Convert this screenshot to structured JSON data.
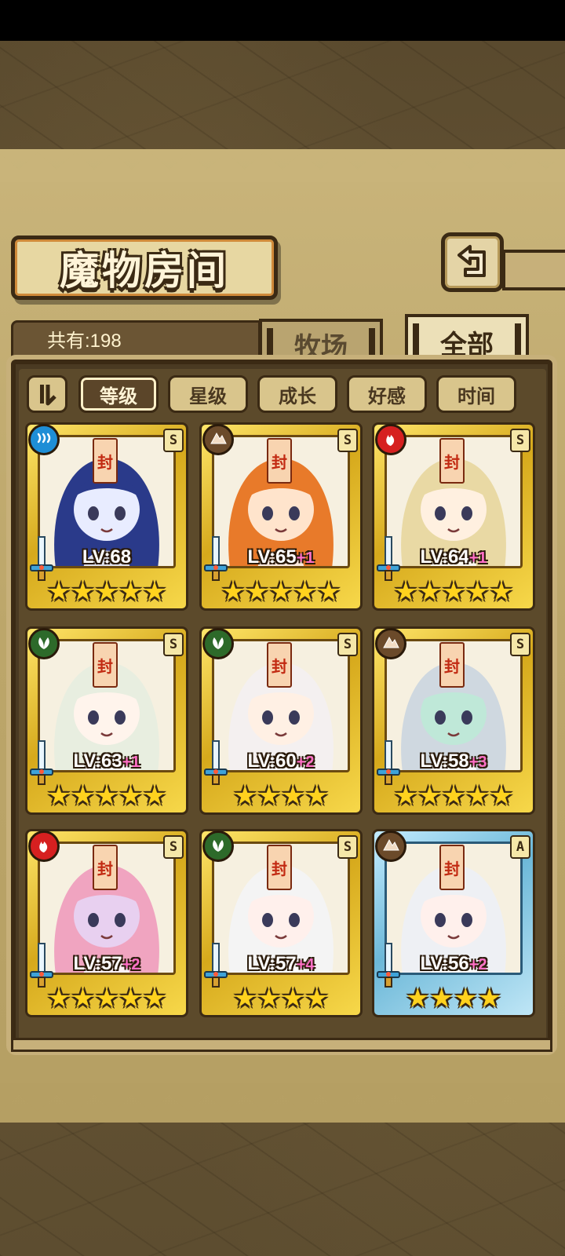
{
  "title": "魔物房间",
  "count_label": "共有:198",
  "tabs": [
    {
      "label": "牧场",
      "active": false
    },
    {
      "label": "全部",
      "active": true
    }
  ],
  "sort_buttons": [
    {
      "label": "等级",
      "active": true
    },
    {
      "label": "星级",
      "active": false
    },
    {
      "label": "成长",
      "active": false
    },
    {
      "label": "好感",
      "active": false
    },
    {
      "label": "时间",
      "active": false
    }
  ],
  "colors": {
    "water": "#1e8ed6",
    "earth": "#6b4a2a",
    "fire": "#d62020",
    "wood": "#2d6a2a",
    "star": "#ffd21e",
    "plus": "#ff6fc7"
  },
  "talisman_char": "封",
  "cards": [
    {
      "element": "water",
      "element_icon": "water-icon",
      "rank": "S",
      "level": "LV:68",
      "plus": "",
      "stars": 5,
      "frame": "gold",
      "hair": "#2a3a8a",
      "skin": "#e8ecff"
    },
    {
      "element": "earth",
      "element_icon": "mountain-icon",
      "rank": "S",
      "level": "LV:65",
      "plus": "+1",
      "stars": 5,
      "frame": "gold",
      "hair": "#e87a2a",
      "skin": "#ffe4cc"
    },
    {
      "element": "fire",
      "element_icon": "flame-icon",
      "rank": "S",
      "level": "LV:64",
      "plus": "+1",
      "stars": 5,
      "frame": "gold",
      "hair": "#e9d9a4",
      "skin": "#fff0e0"
    },
    {
      "element": "wood",
      "element_icon": "leaf-icon",
      "rank": "S",
      "level": "LV:63",
      "plus": "+1",
      "stars": 5,
      "frame": "gold",
      "hair": "#e8eee0",
      "skin": "#fff4ec"
    },
    {
      "element": "wood",
      "element_icon": "leaf-icon",
      "rank": "S",
      "level": "LV:60",
      "plus": "+2",
      "stars": 4,
      "frame": "gold",
      "hair": "#f4f0f0",
      "skin": "#fff0e4"
    },
    {
      "element": "earth",
      "element_icon": "mountain-icon",
      "rank": "S",
      "level": "LV:58",
      "plus": "+3",
      "stars": 5,
      "frame": "gold",
      "hair": "#cfd8e0",
      "skin": "#bfe8d8"
    },
    {
      "element": "fire",
      "element_icon": "flame-icon",
      "rank": "S",
      "level": "LV:57",
      "plus": "+2",
      "stars": 5,
      "frame": "gold",
      "hair": "#f0a4c0",
      "skin": "#e8d0f0"
    },
    {
      "element": "wood",
      "element_icon": "leaf-icon",
      "rank": "S",
      "level": "LV:57",
      "plus": "+4",
      "stars": 4,
      "frame": "gold",
      "hair": "#f4f4f4",
      "skin": "#fff0ec"
    },
    {
      "element": "earth",
      "element_icon": "mountain-icon",
      "rank": "A",
      "level": "LV:56",
      "plus": "+2",
      "stars": 4,
      "frame": "blue",
      "hair": "#eef0f4",
      "skin": "#fff0ec"
    }
  ]
}
